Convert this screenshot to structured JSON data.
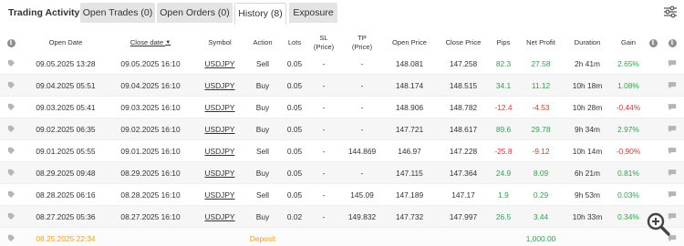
{
  "header": {
    "title": "Trading Activity",
    "tabs": [
      {
        "label": "Open Trades (0)"
      },
      {
        "label": "Open Orders (0)"
      },
      {
        "label": "History (8)"
      },
      {
        "label": "Exposure"
      }
    ],
    "active_tab": "History (8)"
  },
  "columns": {
    "open_date": "Open Date",
    "close_date": "Close date",
    "sort_indicator": "▼",
    "symbol": "Symbol",
    "action": "Action",
    "lots": "Lots",
    "sl_line1": "SL",
    "sl_line2": "(Price)",
    "tp_line1": "TP",
    "tp_line2": "(Price)",
    "open_price": "Open Price",
    "close_price": "Close Price",
    "pips": "Pips",
    "net_profit": "Net Profit",
    "duration": "Duration",
    "gain": "Gain"
  },
  "rows": [
    {
      "open_date": "09.05.2025 13:28",
      "close_date": "09.05.2025 16:10",
      "symbol": "USDJPY",
      "action": "Sell",
      "lots": "0.05",
      "sl": "-",
      "tp": "-",
      "open_price": "148.081",
      "close_price": "147.258",
      "pips": "82.3",
      "net_profit": "27.58",
      "duration": "2h 41m",
      "gain": "2.65%",
      "sign": "pos"
    },
    {
      "open_date": "09.04.2025 05:51",
      "close_date": "09.04.2025 16:10",
      "symbol": "USDJPY",
      "action": "Buy",
      "lots": "0.05",
      "sl": "-",
      "tp": "-",
      "open_price": "148.174",
      "close_price": "148.515",
      "pips": "34.1",
      "net_profit": "11.12",
      "duration": "10h 18m",
      "gain": "1.08%",
      "sign": "pos"
    },
    {
      "open_date": "09.03.2025 05:41",
      "close_date": "09.03.2025 16:10",
      "symbol": "USDJPY",
      "action": "Buy",
      "lots": "0.05",
      "sl": "-",
      "tp": "-",
      "open_price": "148.906",
      "close_price": "148.782",
      "pips": "-12.4",
      "net_profit": "-4.53",
      "duration": "10h 28m",
      "gain": "-0.44%",
      "sign": "neg"
    },
    {
      "open_date": "09.02.2025 06:35",
      "close_date": "09.02.2025 16:10",
      "symbol": "USDJPY",
      "action": "Buy",
      "lots": "0.05",
      "sl": "-",
      "tp": "-",
      "open_price": "147.721",
      "close_price": "148.617",
      "pips": "89.6",
      "net_profit": "29.78",
      "duration": "9h 34m",
      "gain": "2.97%",
      "sign": "pos"
    },
    {
      "open_date": "09.01.2025 05:55",
      "close_date": "09.01.2025 16:10",
      "symbol": "USDJPY",
      "action": "Sell",
      "lots": "0.05",
      "sl": "-",
      "tp": "144.869",
      "open_price": "146.97",
      "close_price": "147.228",
      "pips": "-25.8",
      "net_profit": "-9.12",
      "duration": "10h 14m",
      "gain": "-0.90%",
      "sign": "neg"
    },
    {
      "open_date": "08.29.2025 09:48",
      "close_date": "08.29.2025 16:10",
      "symbol": "USDJPY",
      "action": "Buy",
      "lots": "0.05",
      "sl": "-",
      "tp": "-",
      "open_price": "147.115",
      "close_price": "147.364",
      "pips": "24.9",
      "net_profit": "8.09",
      "duration": "6h 21m",
      "gain": "0.81%",
      "sign": "pos"
    },
    {
      "open_date": "08.28.2025 06:16",
      "close_date": "08.28.2025 16:10",
      "symbol": "USDJPY",
      "action": "Sell",
      "lots": "0.05",
      "sl": "-",
      "tp": "145.09",
      "open_price": "147.189",
      "close_price": "147.17",
      "pips": "1.9",
      "net_profit": "0.29",
      "duration": "9h 53m",
      "gain": "0.03%",
      "sign": "pos"
    },
    {
      "open_date": "08.27.2025 05:36",
      "close_date": "08.27.2025 16:10",
      "symbol": "USDJPY",
      "action": "Buy",
      "lots": "0.02",
      "sl": "-",
      "tp": "149.832",
      "open_price": "147.732",
      "close_price": "147.997",
      "pips": "26.5",
      "net_profit": "3.44",
      "duration": "10h 33m",
      "gain": "0.34%",
      "sign": "pos"
    }
  ],
  "deposit": {
    "date": "08.25.2025 22:34",
    "action": "Deposit",
    "net_profit": "1,000.00"
  },
  "icons": {
    "info": "info-icon",
    "tag": "tag-icon",
    "comment": "comment-icon",
    "filter": "filter-settings-icon",
    "zoom": "zoom-in-icon"
  },
  "colors": {
    "positive": "#2da44e",
    "negative": "#e03131",
    "deposit": "#f0a020",
    "tab_bg": "#e4e4e4"
  }
}
